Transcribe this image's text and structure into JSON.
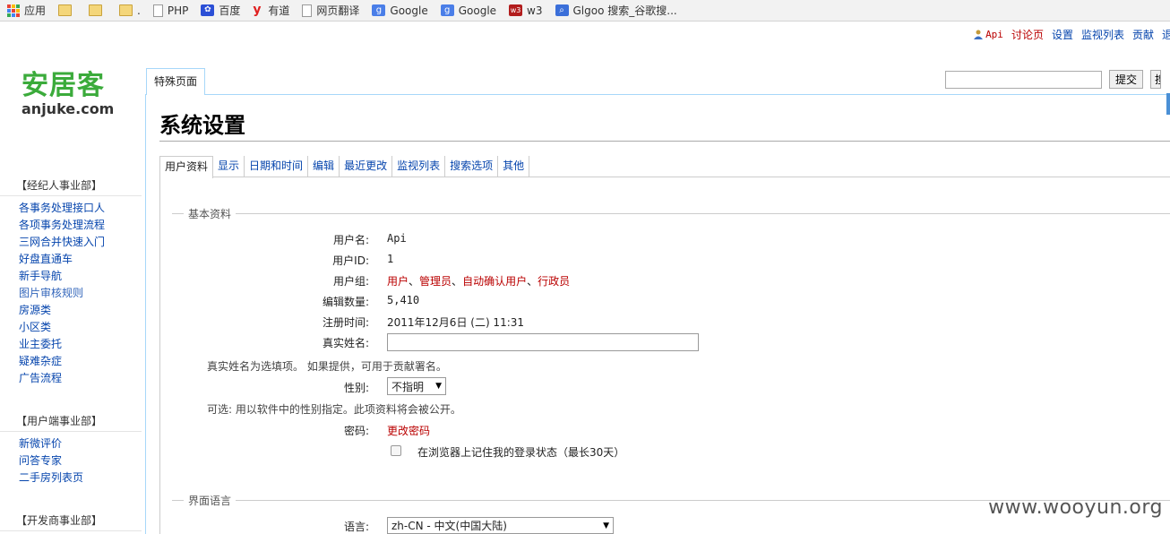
{
  "bookmarks": [
    {
      "label": "应用",
      "icon": "apps-grid-icon"
    },
    {
      "label": "",
      "icon": "folder-icon"
    },
    {
      "label": "",
      "icon": "folder-icon"
    },
    {
      "label": ".",
      "icon": "folder-icon"
    },
    {
      "label": "PHP",
      "icon": "page-icon"
    },
    {
      "label": "百度",
      "icon": "baidu-paw-icon"
    },
    {
      "label": "有道",
      "icon": "youdao-icon"
    },
    {
      "label": "网页翻译",
      "icon": "page-icon"
    },
    {
      "label": "Google",
      "icon": "google-icon"
    },
    {
      "label": "Google",
      "icon": "google-icon"
    },
    {
      "label": "w3",
      "icon": "w3-icon"
    },
    {
      "label": "Glgoo 搜索_谷歌搜...",
      "icon": "glgoo-search-icon"
    }
  ],
  "personal_tools": {
    "user": "Api",
    "talk": "讨论页",
    "preferences": "设置",
    "watchlist": "监视列表",
    "contributions": "贡献",
    "more": "退"
  },
  "logo": {
    "cn": "安居客",
    "en": "anjuke.com"
  },
  "sidebar": [
    {
      "title": "【经纪人事业部】",
      "items": [
        "各事务处理接口人",
        "各项事务处理流程",
        "三网合并快速入门",
        "好盘直通车",
        "新手导航",
        "图片审核规则",
        "房源类",
        "小区类",
        "业主委托",
        "疑难杂症",
        "广告流程"
      ]
    },
    {
      "title": "【用户端事业部】",
      "items": [
        "新微评价",
        "问答专家",
        "二手房列表页"
      ]
    },
    {
      "title": "【开发商事业部】",
      "items": []
    }
  ],
  "namespace_tab": "特殊页面",
  "search": {
    "value": "",
    "submit": "提交",
    "search_btn": "搜"
  },
  "page_title": "系统设置",
  "pref_tabs": [
    "用户资料",
    "显示",
    "日期和时间",
    "编辑",
    "最近更改",
    "监视列表",
    "搜索选项",
    "其他"
  ],
  "section_basic": "基本资料",
  "fields": {
    "username_label": "用户名:",
    "username_value": "Api",
    "userid_label": "用户ID:",
    "userid_value": "1",
    "groups_label": "用户组:",
    "groups": [
      "用户",
      "管理员",
      "自动确认用户",
      "行政员"
    ],
    "edits_label": "编辑数量:",
    "edits_value": "5,410",
    "reg_label": "注册时间:",
    "reg_value": "2011年12月6日 (二) 11:31",
    "realname_label": "真实姓名:",
    "realname_value": "",
    "realname_help": "真实姓名为选填项。 如果提供，可用于贡献署名。",
    "gender_label": "性别:",
    "gender_value": "不指明",
    "gender_help": "可选: 用以软件中的性别指定。此项资料将会被公开。",
    "password_label": "密码:",
    "password_link": "更改密码",
    "remember_label": "在浏览器上记住我的登录状态（最长30天）"
  },
  "section_lang": "界面语言",
  "language_label": "语言:",
  "language_value": "zh-CN - 中文(中国大陆)",
  "watermark": "www.wooyun.org"
}
